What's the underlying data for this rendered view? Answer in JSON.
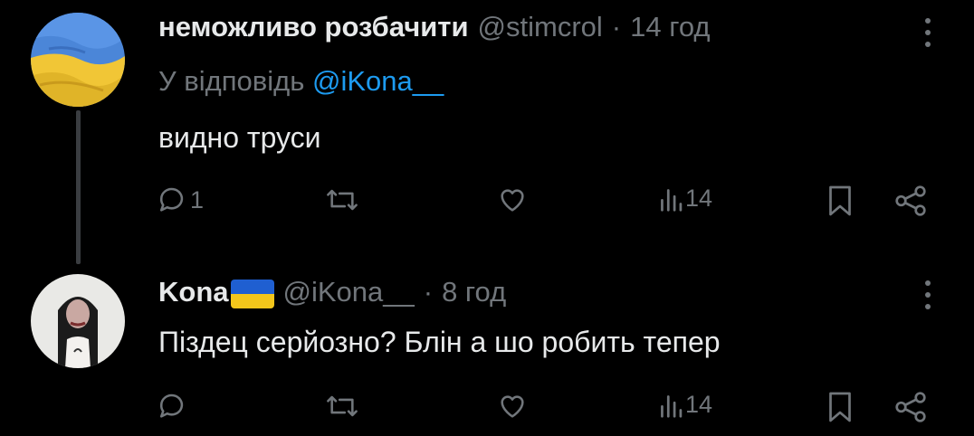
{
  "post1": {
    "author_name": "неможливо розбачити",
    "handle": "@stimcrol",
    "separator": "·",
    "time": "14 год",
    "reply_prefix": "У відповідь",
    "reply_to": "@iKona__",
    "text": "видно труси",
    "reply_count": "1",
    "repost_count": "",
    "like_count": "",
    "views_count": "14"
  },
  "post2": {
    "author_name": "Kona",
    "handle": "@iKona__",
    "separator": "·",
    "time": "8 год",
    "text": "Піздец серйозно? Блін а шо робить тепер",
    "reply_count": "",
    "repost_count": "",
    "like_count": "",
    "views_count": "14"
  },
  "colors": {
    "background": "#000000",
    "text": "#e7e9ea",
    "muted": "#71767b",
    "mention": "#1d9bf0",
    "flag_blue": "#1f5fd1",
    "flag_yellow": "#f3c61b"
  },
  "icons": [
    "reply-icon",
    "repost-icon",
    "like-icon",
    "views-icon",
    "bookmark-icon",
    "share-icon",
    "more-icon",
    "ukraine-flag-emoji"
  ]
}
